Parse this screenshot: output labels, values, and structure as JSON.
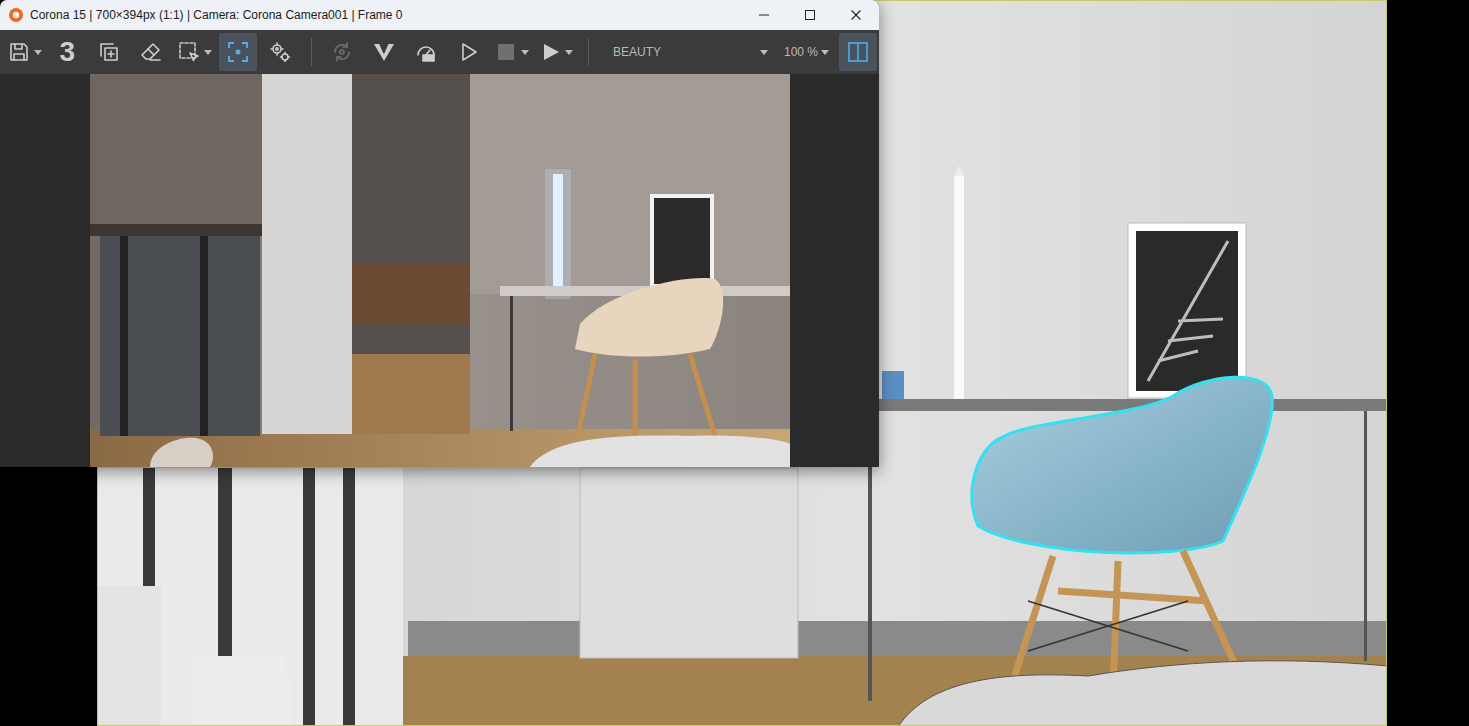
{
  "window": {
    "title": "Corona 15 | 700×394px (1:1) | Camera: Corona Camera001 | Frame 0"
  },
  "toolbar": {
    "items": [
      {
        "kind": "icon",
        "dropdown": true,
        "selected": false,
        "disabled": false
      },
      {
        "kind": "label",
        "label": "3",
        "selected": false,
        "disabled": false
      },
      {
        "kind": "icon",
        "dropdown": false,
        "selected": false,
        "disabled": false
      },
      {
        "kind": "icon",
        "dropdown": false,
        "selected": false,
        "disabled": false
      },
      {
        "kind": "icon",
        "dropdown": true,
        "selected": false,
        "disabled": false
      },
      {
        "kind": "icon",
        "dropdown": false,
        "selected": true,
        "disabled": false
      },
      {
        "kind": "icon",
        "dropdown": false,
        "selected": false,
        "disabled": false
      },
      {
        "kind": "separator"
      },
      {
        "kind": "icon",
        "dropdown": false,
        "selected": false,
        "disabled": true
      },
      {
        "kind": "icon",
        "dropdown": false,
        "selected": false,
        "disabled": false
      },
      {
        "kind": "icon",
        "dropdown": false,
        "selected": false,
        "disabled": false
      },
      {
        "kind": "icon",
        "dropdown": false,
        "selected": false,
        "disabled": false
      },
      {
        "kind": "icon",
        "dropdown": true,
        "selected": false,
        "disabled": true
      },
      {
        "kind": "icon",
        "dropdown": true,
        "selected": false,
        "disabled": false
      },
      {
        "kind": "separator"
      },
      {
        "kind": "select",
        "label": "BEAUTY"
      },
      {
        "kind": "select",
        "label": "100 %"
      },
      {
        "kind": "icon",
        "dropdown": false,
        "selected": true,
        "disabled": false
      }
    ]
  },
  "viewport": {
    "active": true
  }
}
